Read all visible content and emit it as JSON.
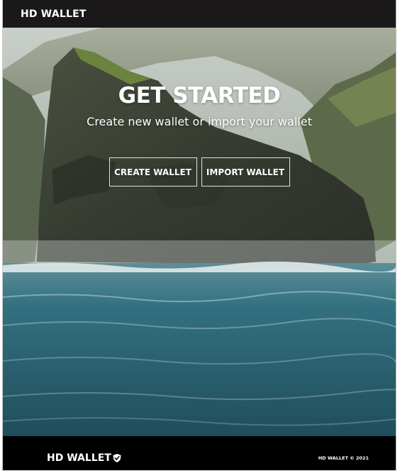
{
  "navbar": {
    "brand": "HD WALLET"
  },
  "hero": {
    "title": "GET STARTED",
    "subtitle": "Create new wallet or import your wallet",
    "create_wallet_label": "CREATE WALLET",
    "import_wallet_label": "IMPORT WALLET",
    "background": "coastal-cliff-and-ocean-photo"
  },
  "footer": {
    "brand": "HD WALLET",
    "logo_icon": "shield-check-icon",
    "copyright": "HD WALLET © 2021"
  },
  "colors": {
    "navbar_bg": "#1b1819",
    "footer_bg": "#000000",
    "text": "#ffffff",
    "ocean": "#2e6a78",
    "cliff": "#3a3f33"
  }
}
